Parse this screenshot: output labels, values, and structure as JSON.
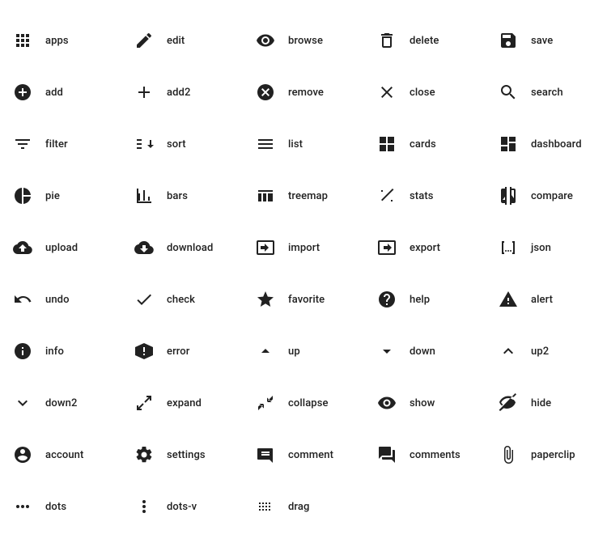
{
  "icons": [
    {
      "id": "apps",
      "label": "apps"
    },
    {
      "id": "edit",
      "label": "edit"
    },
    {
      "id": "browse",
      "label": "browse"
    },
    {
      "id": "delete",
      "label": "delete"
    },
    {
      "id": "save",
      "label": "save"
    },
    {
      "id": "add",
      "label": "add"
    },
    {
      "id": "add2",
      "label": "add2"
    },
    {
      "id": "remove",
      "label": "remove"
    },
    {
      "id": "close",
      "label": "close"
    },
    {
      "id": "search",
      "label": "search"
    },
    {
      "id": "filter",
      "label": "filter"
    },
    {
      "id": "sort",
      "label": "sort"
    },
    {
      "id": "list",
      "label": "list"
    },
    {
      "id": "cards",
      "label": "cards"
    },
    {
      "id": "dashboard",
      "label": "dashboard"
    },
    {
      "id": "pie",
      "label": "pie"
    },
    {
      "id": "bars",
      "label": "bars"
    },
    {
      "id": "treemap",
      "label": "treemap"
    },
    {
      "id": "stats",
      "label": "stats"
    },
    {
      "id": "compare",
      "label": "compare"
    },
    {
      "id": "upload",
      "label": "upload"
    },
    {
      "id": "download",
      "label": "download"
    },
    {
      "id": "import",
      "label": "import"
    },
    {
      "id": "export",
      "label": "export"
    },
    {
      "id": "json",
      "label": "json"
    },
    {
      "id": "undo",
      "label": "undo"
    },
    {
      "id": "check",
      "label": "check"
    },
    {
      "id": "favorite",
      "label": "favorite"
    },
    {
      "id": "help",
      "label": "help"
    },
    {
      "id": "alert",
      "label": "alert"
    },
    {
      "id": "info",
      "label": "info"
    },
    {
      "id": "error",
      "label": "error"
    },
    {
      "id": "up",
      "label": "up"
    },
    {
      "id": "down",
      "label": "down"
    },
    {
      "id": "up2",
      "label": "up2"
    },
    {
      "id": "down2",
      "label": "down2"
    },
    {
      "id": "expand",
      "label": "expand"
    },
    {
      "id": "collapse",
      "label": "collapse"
    },
    {
      "id": "show",
      "label": "show"
    },
    {
      "id": "hide",
      "label": "hide"
    },
    {
      "id": "account",
      "label": "account"
    },
    {
      "id": "settings",
      "label": "settings"
    },
    {
      "id": "comment",
      "label": "comment"
    },
    {
      "id": "comments",
      "label": "comments"
    },
    {
      "id": "paperclip",
      "label": "paperclip"
    },
    {
      "id": "dots",
      "label": "dots"
    },
    {
      "id": "dots-v",
      "label": "dots-v"
    },
    {
      "id": "drag",
      "label": "drag"
    }
  ]
}
